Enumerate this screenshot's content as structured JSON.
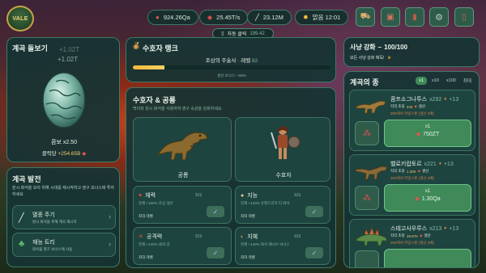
{
  "app": {
    "logo": "VALE"
  },
  "resources": {
    "fossils": "924.26Qa",
    "meat": "25.45T/s",
    "bones": "23.12M",
    "weather": "맑음 12:01"
  },
  "autoclick": {
    "label": "자동 클릭",
    "value": "199.42"
  },
  "egg_panel": {
    "title": "계곡 돌보기",
    "float1": "+1.02T",
    "float2": "+1.02T",
    "bonus": "콤보 x2.50",
    "click_label": "클릭당",
    "click_value": "+254.65B"
  },
  "progress_panel": {
    "title": "계곡 발전",
    "desc": "원시 화석을 모아 위해 시대를 재시작하고 영구 보너스에 투자하세요",
    "items": [
      {
        "label": "멸종 주기",
        "desc": "원시 화석을 위해 계곡 재시작"
      },
      {
        "label": "재능 트리",
        "desc": "화석을 영구 보너스에 사용"
      }
    ]
  },
  "guardian_rank": {
    "title": "수호자 랭크",
    "rank_name": "조상의 주술사",
    "level_label": "레벨",
    "level": "82",
    "progress": 0.16,
    "bonus": "생산 보너스: +80%"
  },
  "guardians": {
    "title": "수호자 & 공룡",
    "desc": "백이와 원시 화석을 사용하여 영구 속성을 강화하세요",
    "left_label": "공룡",
    "right_label": "수호자",
    "stats": [
      {
        "label": "체력",
        "max": "최대",
        "desc": "현재 +100% 조상 생산",
        "status": "최대 레벨"
      },
      {
        "label": "지능",
        "max": "최대",
        "desc": "현재 +140% 유래드리지 티 화석",
        "status": "최대 레벨"
      },
      {
        "label": "공격력",
        "max": "최대",
        "desc": "현재 +140% 클릭 강",
        "status": "최대 레벨"
      },
      {
        "label": "지혜",
        "max": "최대",
        "desc": "현재 +140% 화석 패시브 보너스",
        "status": "최대 레벨"
      }
    ]
  },
  "hunt": {
    "title": "사냥 강화",
    "count": "100/100",
    "desc": "모든 사냥 강화 획득!"
  },
  "species": {
    "title": "계곡의 종",
    "multipliers": [
      "x1",
      "x10",
      "x100",
      "최대"
    ],
    "active_multiplier": 0,
    "items": [
      {
        "name": "콤프소그나투스",
        "count": "x292",
        "stars": "+13",
        "prod_label": "각각 초당",
        "prod_value": "233",
        "prod_suffix": "생산",
        "milestone": "300에서 마일스톤 (생산 2배)",
        "buy_label": "x1",
        "buy_price": "750ZT"
      },
      {
        "name": "벨로키랍토르",
        "count": "x221",
        "stars": "+13",
        "prod_label": "각각 초당",
        "prod_value": "1.30K",
        "prod_suffix": "생산",
        "milestone": "300에서 마일스톤 (생산 2배)",
        "buy_label": "x1",
        "buy_price": "1.30Qa"
      },
      {
        "name": "스테고사우루스",
        "count": "x213",
        "stars": "+13",
        "prod_label": "각각 초당",
        "prod_value": "18.67K",
        "prod_suffix": "생산",
        "milestone": "300에서 마일스톤 (생산 2배)",
        "buy_label": "",
        "buy_price": ""
      }
    ]
  }
}
